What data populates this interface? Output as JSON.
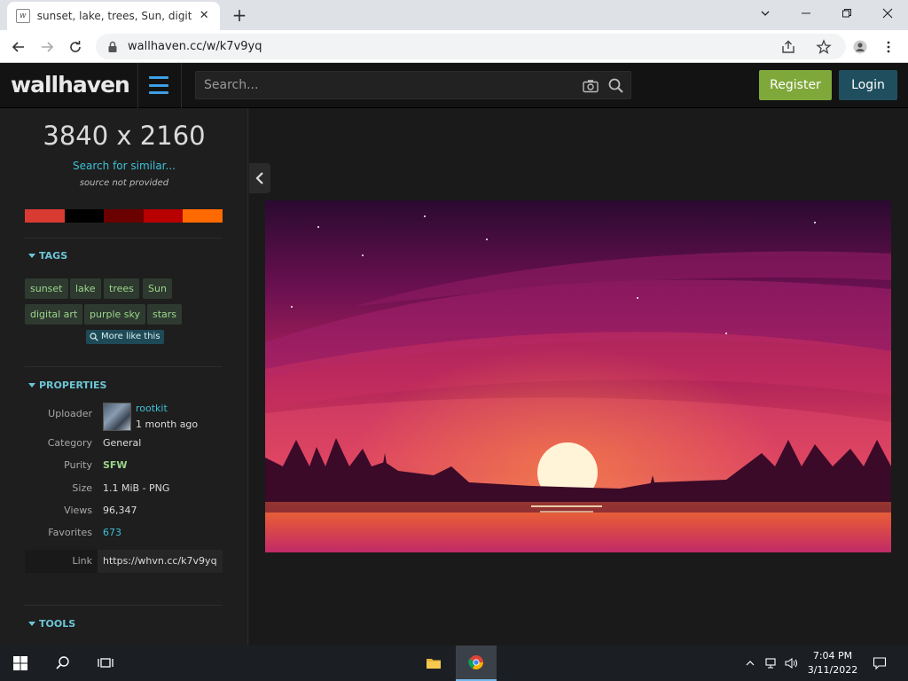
{
  "browser": {
    "tab_title": "sunset, lake, trees, Sun, digital art",
    "favicon_text": "w",
    "url": "wallhaven.cc/w/k7v9yq"
  },
  "header": {
    "logo": "wallhaven",
    "search_placeholder": "Search...",
    "register": "Register",
    "login": "Login"
  },
  "sidebar": {
    "resolution": "3840 x 2160",
    "search_similar": "Search for similar...",
    "source": "source not provided",
    "palette": [
      "#d93a32",
      "#000000",
      "#6a0000",
      "#b80000",
      "#ff6a00"
    ],
    "tags_heading": "TAGS",
    "tags": [
      "sunset",
      "lake",
      "trees",
      "Sun",
      "digital art",
      "purple sky",
      "stars"
    ],
    "more_like_this": "More like this",
    "properties_heading": "PROPERTIES",
    "properties": {
      "uploader_label": "Uploader",
      "uploader_name": "rootkit",
      "uploaded_ago": "1 month ago",
      "category_label": "Category",
      "category": "General",
      "purity_label": "Purity",
      "purity": "SFW",
      "size_label": "Size",
      "size": "1.1 MiB - PNG",
      "views_label": "Views",
      "views": "96,347",
      "favorites_label": "Favorites",
      "favorites": "673",
      "link_label": "Link",
      "link": "https://whvn.cc/k7v9yq"
    },
    "tools_heading": "TOOLS"
  },
  "taskbar": {
    "time": "7:04 PM",
    "date": "3/11/2022"
  },
  "colors": {
    "accent_blue": "#3ea0e6",
    "register_green": "#7fa83a",
    "login_teal": "#1f4f5e",
    "tag_green": "#9bd48a",
    "link_cyan": "#3ec0d6",
    "purity_green": "#9bd48a"
  }
}
